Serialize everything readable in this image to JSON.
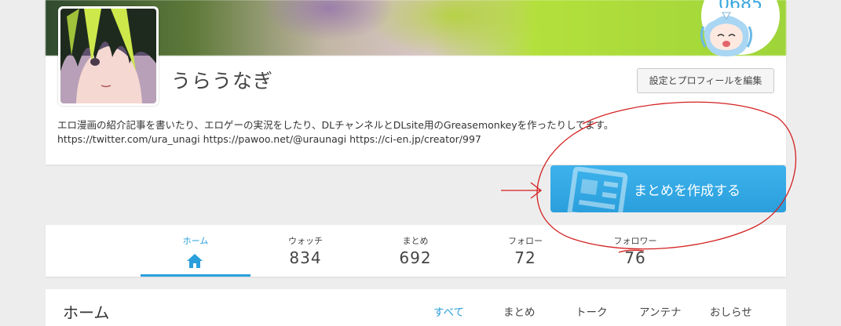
{
  "profile": {
    "cover_count": "0685",
    "username": "うらうなぎ",
    "edit_button": "設定とプロフィールを編集",
    "bio_line1": "エロ漫画の紹介記事を書いたり、エロゲーの実況をしたり、DLチャンネルとDLsite用のGreasemonkeyを作ったりしてます。",
    "bio_line2": "https://twitter.com/ura_unagi https://pawoo.net/@uraunagi https://ci-en.jp/creator/997"
  },
  "create_button": {
    "label": "まとめを作成する"
  },
  "stats": [
    {
      "label": "ホーム",
      "value": "",
      "icon": "home-icon",
      "active": true
    },
    {
      "label": "ウォッチ",
      "value": "834"
    },
    {
      "label": "まとめ",
      "value": "692"
    },
    {
      "label": "フォロー",
      "value": "72"
    },
    {
      "label": "フォロワー",
      "value": "76"
    }
  ],
  "home_section": {
    "title": "ホーム",
    "tabs": [
      {
        "label": "すべて",
        "active": true
      },
      {
        "label": "まとめ"
      },
      {
        "label": "トーク"
      },
      {
        "label": "アンテナ"
      },
      {
        "label": "おしらせ"
      }
    ]
  },
  "colors": {
    "accent": "#2a9fdc",
    "annotation_red": "#d42020"
  }
}
